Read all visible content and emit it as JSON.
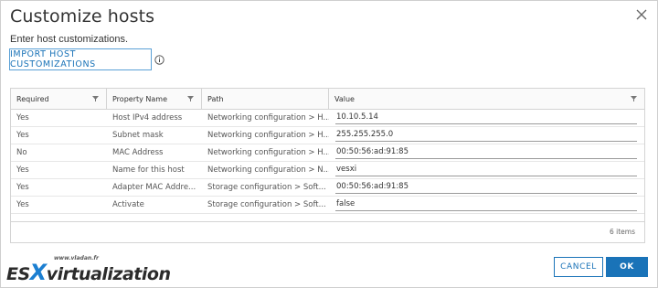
{
  "dialog": {
    "title": "Customize hosts",
    "subtitle": "Enter host customizations.",
    "import_button": "IMPORT HOST CUSTOMIZATIONS",
    "close_icon": "close-icon",
    "info_icon": "info-icon"
  },
  "grid": {
    "columns": [
      "Required",
      "Property Name",
      "Path",
      "Value"
    ],
    "rows": [
      {
        "required": "Yes",
        "property": "Host IPv4 address",
        "path": "Networking configuration > H...",
        "value": "10.10.5.14"
      },
      {
        "required": "Yes",
        "property": "Subnet mask",
        "path": "Networking configuration > H...",
        "value": "255.255.255.0"
      },
      {
        "required": "No",
        "property": "MAC Address",
        "path": "Networking configuration > H...",
        "value": "00:50:56:ad:91:85"
      },
      {
        "required": "Yes",
        "property": "Name for this host",
        "path": "Networking configuration > N...",
        "value": "vesxi"
      },
      {
        "required": "Yes",
        "property": "Adapter MAC Addre...",
        "path": "Storage configuration > Soft...",
        "value": "00:50:56:ad:91:85"
      },
      {
        "required": "Yes",
        "property": "Activate",
        "path": "Storage configuration > Soft...",
        "value": "false"
      }
    ],
    "item_count": "6 items"
  },
  "watermark": {
    "url": "www.vladan.fr",
    "brand_es": "ES",
    "brand_x": "X",
    "brand_rest": "virtualization"
  },
  "footer": {
    "cancel": "CANCEL",
    "ok": "OK"
  },
  "colors": {
    "accent": "#1a73b8",
    "border": "#d4d4d4"
  }
}
